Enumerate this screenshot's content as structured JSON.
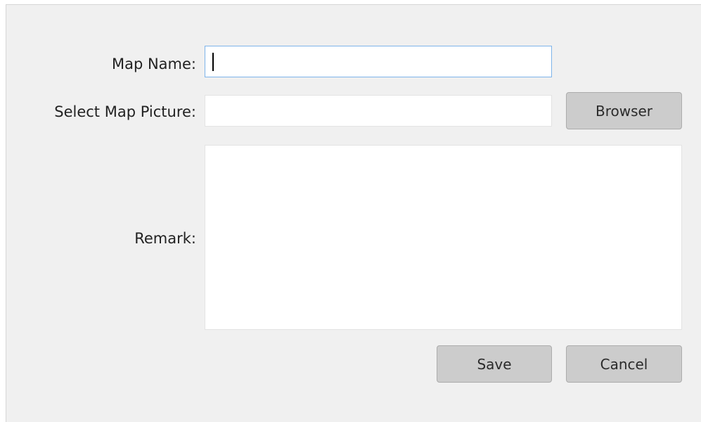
{
  "form": {
    "map_name_label": "Map Name:",
    "map_name_value": "",
    "select_picture_label": "Select Map Picture:",
    "select_picture_value": "",
    "remark_label": "Remark:",
    "remark_value": ""
  },
  "buttons": {
    "browse_label": "Browser",
    "save_label": "Save",
    "cancel_label": "Cancel"
  },
  "colors": {
    "dialog_bg": "#f0f0f0",
    "field_bg": "#ffffff",
    "focus_border": "#7eb4ea",
    "button_bg": "#cccccc"
  }
}
